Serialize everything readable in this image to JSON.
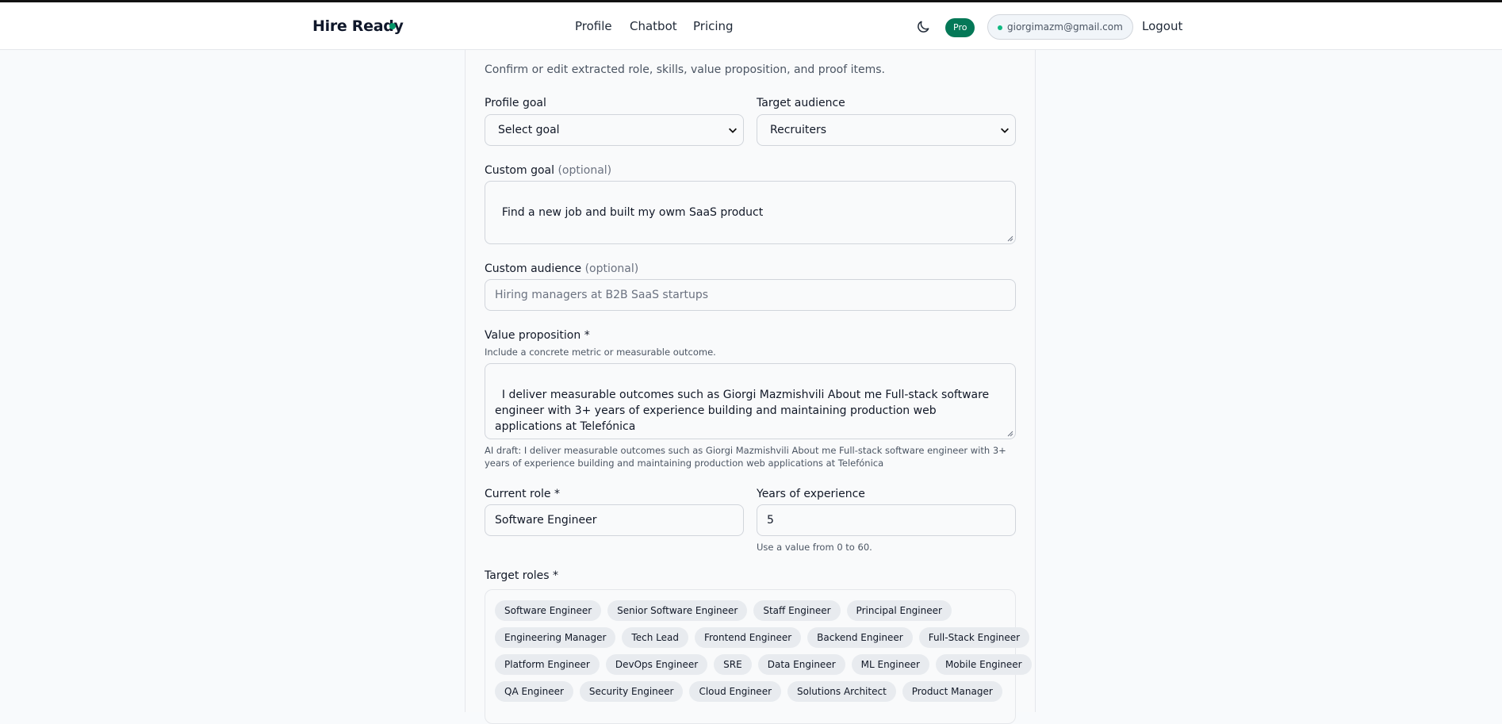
{
  "header": {
    "brand": "Hire Ready",
    "nav": [
      "Profile",
      "Chatbot",
      "Pricing"
    ],
    "pro_badge": "Pro",
    "email": "giorgimazm@gmail.com",
    "logout": "Logout"
  },
  "form": {
    "description": "Confirm or edit extracted role, skills, value proposition, and proof items.",
    "profile_goal": {
      "label": "Profile goal",
      "value": "Select goal"
    },
    "target_audience": {
      "label": "Target audience",
      "value": "Recruiters"
    },
    "custom_goal": {
      "label": "Custom goal",
      "optional": "(optional)",
      "value": "Find a new job and built my owm SaaS product"
    },
    "custom_audience": {
      "label": "Custom audience",
      "optional": "(optional)",
      "placeholder": "Hiring managers at B2B SaaS startups"
    },
    "value_proposition": {
      "label": "Value proposition *",
      "hint": "Include a concrete metric or measurable outcome.",
      "value": "I deliver measurable outcomes such as Giorgi Mazmishvili About me Full-stack software engineer with 3+ years of experience building and maintaining production web applications at Telefónica",
      "ai_draft": "AI draft: I deliver measurable outcomes such as Giorgi Mazmishvili About me Full-stack software engineer with 3+ years of experience building and maintaining production web applications at Telefónica"
    },
    "current_role": {
      "label": "Current role *",
      "value": "Software Engineer"
    },
    "years_experience": {
      "label": "Years of experience",
      "value": "5",
      "hint": "Use a value from 0 to 60."
    },
    "target_roles": {
      "label": "Target roles *",
      "rows": [
        [
          "Software Engineer",
          "Senior Software Engineer",
          "Staff Engineer",
          "Principal Engineer"
        ],
        [
          "Engineering Manager",
          "Tech Lead",
          "Frontend Engineer",
          "Backend Engineer",
          "Full-Stack Engineer"
        ],
        [
          "Platform Engineer",
          "DevOps Engineer",
          "SRE",
          "Data Engineer",
          "ML Engineer",
          "Mobile Engineer"
        ],
        [
          "QA Engineer",
          "Security Engineer",
          "Cloud Engineer",
          "Solutions Architect",
          "Product Manager"
        ]
      ]
    }
  }
}
